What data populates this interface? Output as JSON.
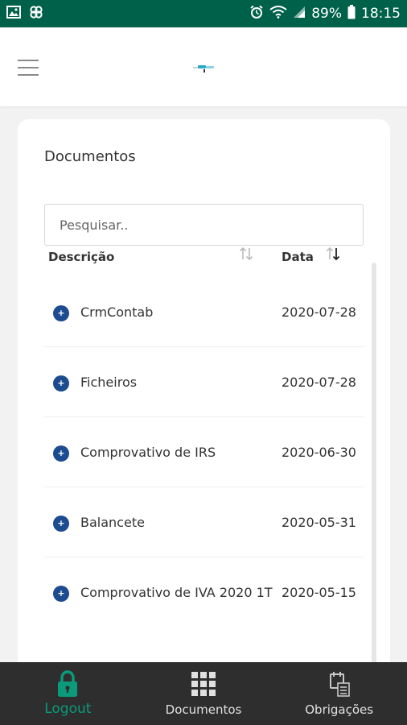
{
  "status_bar": {
    "battery": "89%",
    "time": "18:15",
    "left_icons": [
      "image-icon",
      "app-notification-icon"
    ],
    "right_icons": [
      "alarm-icon",
      "wifi-icon",
      "signal-icon",
      "battery-icon"
    ]
  },
  "header": {
    "menu_icon": "hamburger-icon",
    "logo": "app-logo"
  },
  "documents": {
    "title": "Documentos",
    "search_placeholder": "Pesquisar..",
    "columns": {
      "description": "Descrição",
      "date": "Data"
    },
    "rows": [
      {
        "description": "CrmContab",
        "date": "2020-07-28"
      },
      {
        "description": "Ficheiros",
        "date": "2020-07-28"
      },
      {
        "description": "Comprovativo de IRS",
        "date": "2020-06-30"
      },
      {
        "description": "Balancete",
        "date": "2020-05-31"
      },
      {
        "description": "Comprovativo de IVA 2020 1T",
        "date": "2020-05-15"
      }
    ]
  },
  "bottom_nav": {
    "items": [
      {
        "label": "Logout",
        "icon": "lock-icon",
        "active": true
      },
      {
        "label": "Documentos",
        "icon": "grid-icon",
        "active": false
      },
      {
        "label": "Obrigações",
        "icon": "calendar-list-icon",
        "active": false
      }
    ]
  },
  "colors": {
    "status_bar": "#00614a",
    "accent": "#0b9a7a",
    "row_icon": "#1c4c8f",
    "bottom_nav": "#2e2e2e"
  }
}
